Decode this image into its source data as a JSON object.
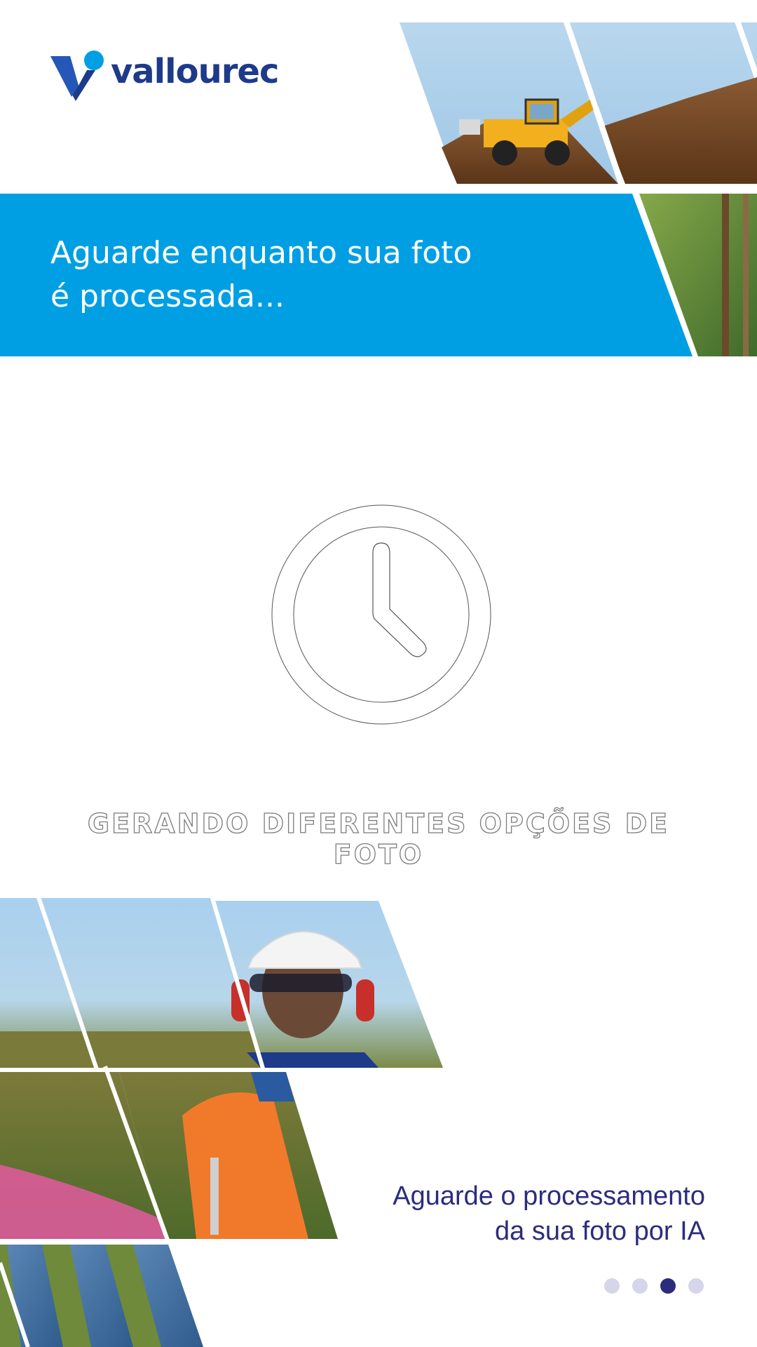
{
  "brand": {
    "name": "vallourec",
    "color_primary": "#1e3a8a",
    "color_accent": "#009fe3"
  },
  "banner": {
    "line1": "Aguarde enquanto sua foto",
    "line2": "é processada...",
    "background": "#009fe3"
  },
  "status": {
    "icon": "clock-icon",
    "text": "GERANDO DIFERENTES OPÇÕES DE FOTO"
  },
  "caption": {
    "line1": "Aguarde o processamento",
    "line2": "da sua foto por IA",
    "color": "#2b2d7c"
  },
  "pager": {
    "count": 4,
    "active_index": 2
  },
  "photos": {
    "top": [
      "excavator-photo",
      "tree-photo"
    ],
    "bottom": [
      "worker-photo",
      "orange-worker-photo",
      "solar-panel-photo"
    ]
  }
}
